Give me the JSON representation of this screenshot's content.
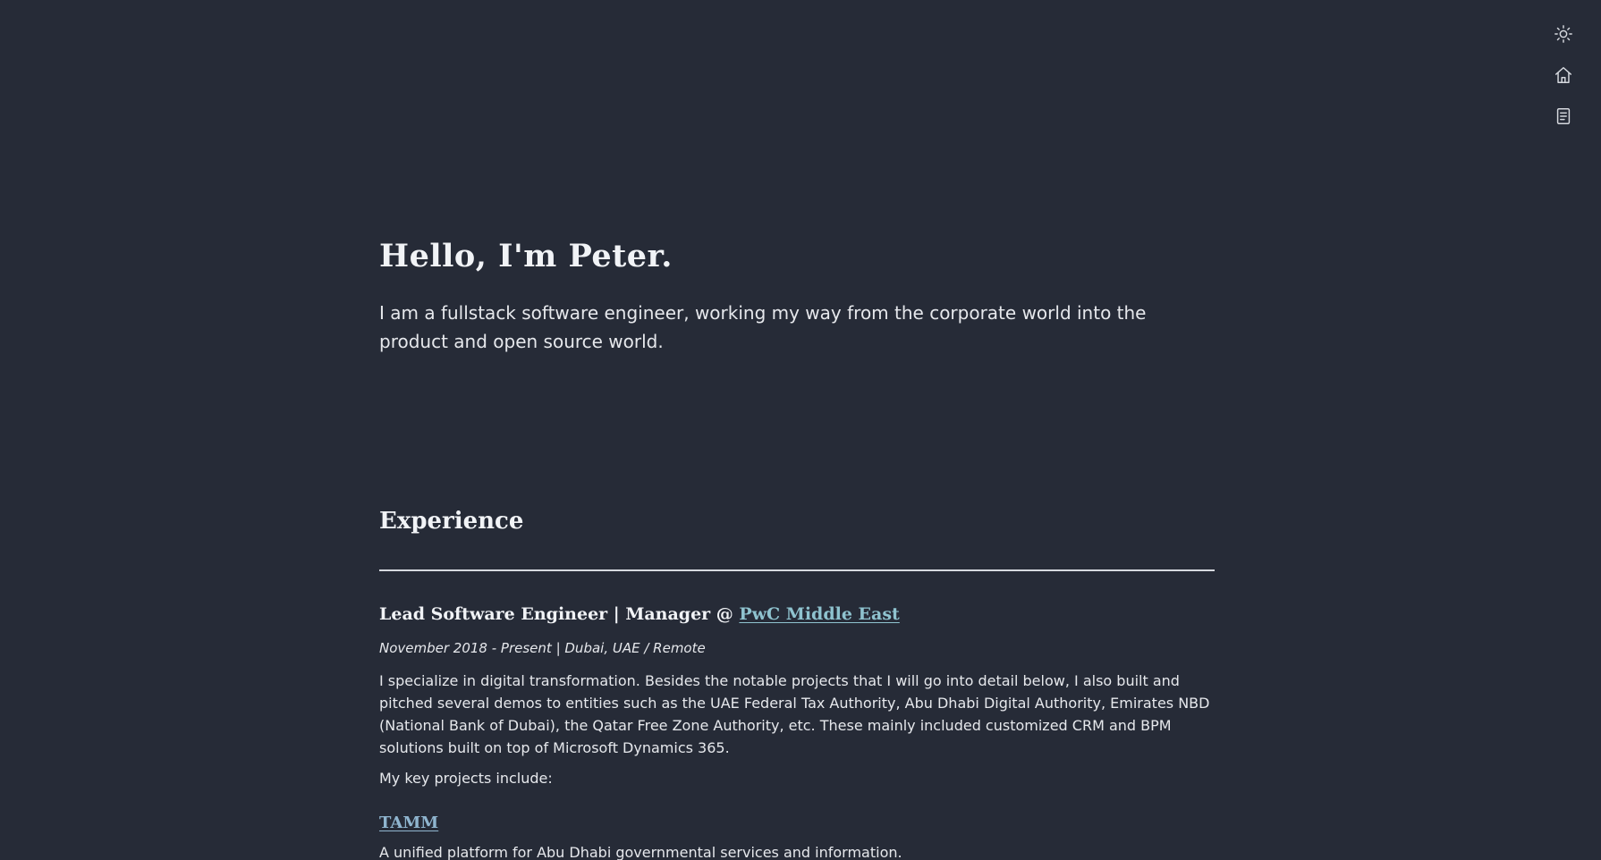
{
  "nav": {
    "icons": [
      "sun-icon",
      "home-icon",
      "document-icon"
    ]
  },
  "hero": {
    "title": "Hello, I'm Peter.",
    "subtitle": "I am a fullstack software engineer, working my way from the corporate world into the product and open source world."
  },
  "experience": {
    "heading": "Experience",
    "job": {
      "title": "Lead Software Engineer | Manager @ ",
      "company": "PwC Middle East",
      "meta": "November 2018 - Present | Dubai, UAE / Remote",
      "description": "I specialize in digital transformation. Besides the notable projects that I will go into detail below, I also built and pitched several demos to entities such as the UAE Federal Tax Authority, Abu Dhabi Digital Authority, Emirates NBD (National Bank of Dubai), the Qatar Free Zone Authority, etc. These mainly included customized CRM and BPM solutions built on top of Microsoft Dynamics 365.",
      "key_projects_label": "My key projects include:"
    },
    "project": {
      "name": "TAMM",
      "description": "A unified platform for Abu Dhabi governmental services and information."
    }
  },
  "colors": {
    "background": "#262b37",
    "text": "#e9ebef",
    "company_link": "#8fc3cf",
    "project_link": "#8fb5cf"
  }
}
